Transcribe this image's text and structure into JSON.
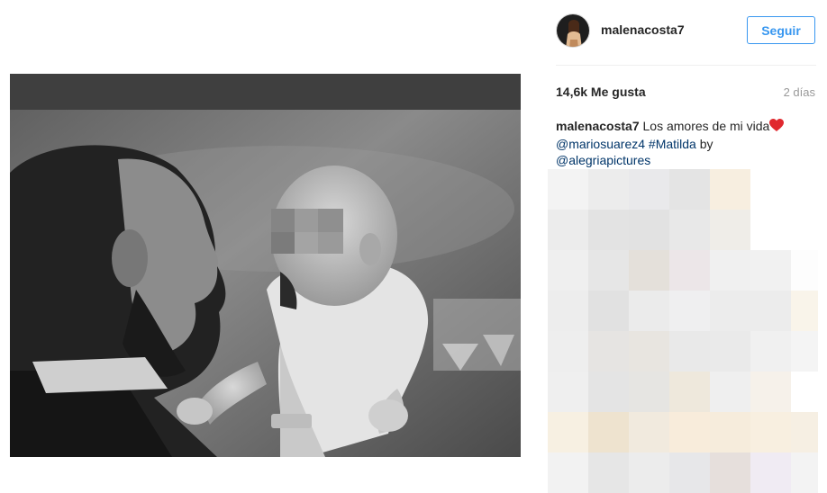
{
  "post": {
    "username": "malenacosta7",
    "follow_label": "Seguir",
    "likes": "14,6k Me gusta",
    "time_ago": "2 días",
    "caption": {
      "user": "malenacosta7",
      "text": "Los amores de mi vida",
      "heart": "heart-emoji",
      "mention1": "@mariosuarez4",
      "hashtag": "#Matilda",
      "by": "by",
      "mention2": "@alegriapictures"
    }
  },
  "colors": {
    "accent": "#3897f0",
    "link": "#003569",
    "muted": "#999999",
    "text": "#262626"
  },
  "mosaic_colors": [
    [
      "#f3f3f3",
      "#ececec",
      "#e9e9eb",
      "#e4e4e4",
      "#f7eee0",
      "#ffffff",
      "#ffffff"
    ],
    [
      "#ececec",
      "#e3e3e3",
      "#e2e2e2",
      "#e8e8e8",
      "#efede8",
      "#ffffff",
      "#ffffff"
    ],
    [
      "#efefef",
      "#e6e6e6",
      "#e4e0da",
      "#ece6e8",
      "#f0f0f0",
      "#f1f1f1",
      "#fdfdfd"
    ],
    [
      "#ededed",
      "#e1e1e1",
      "#ebebeb",
      "#efeff0",
      "#ececec",
      "#ececec",
      "#f9f4ea"
    ],
    [
      "#eeeeee",
      "#e6e4e2",
      "#e8e5e0",
      "#e9e9e9",
      "#eaeaea",
      "#f0f0f0",
      "#f4f4f4"
    ],
    [
      "#efefef",
      "#e4e4e4",
      "#e6e5e2",
      "#eee8dc",
      "#efefef",
      "#f6f1ea",
      "#ffffff"
    ],
    [
      "#f7f0e2",
      "#eee3cf",
      "#f1eade",
      "#f8ecdb",
      "#f6ecdc",
      "#f8efe0",
      "#f6efe3"
    ],
    [
      "#f2f2f2",
      "#e6e6e6",
      "#ececec",
      "#e7e7e9",
      "#e6dfdc",
      "#f0ebf3",
      "#f3f3f3"
    ]
  ]
}
